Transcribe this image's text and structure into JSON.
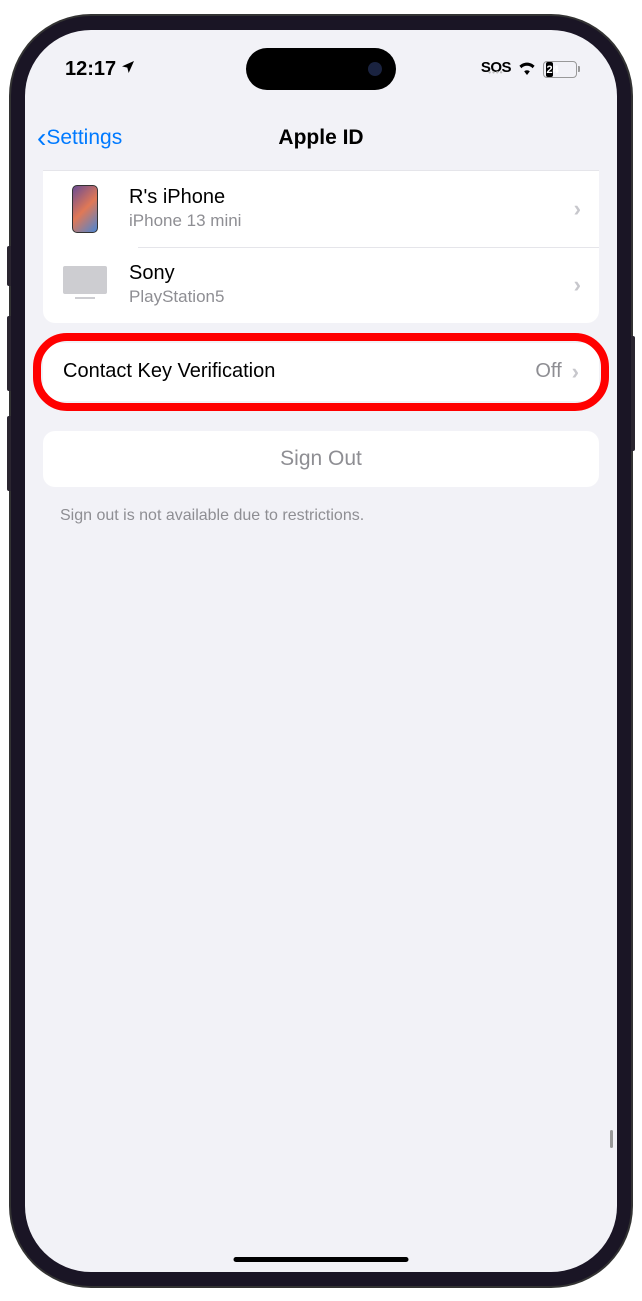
{
  "status": {
    "time": "12:17",
    "sos": "SOS",
    "battery_level": "24"
  },
  "nav": {
    "back_label": "Settings",
    "title": "Apple ID"
  },
  "devices": [
    {
      "name": "R's iPhone",
      "subtitle": "iPhone 13 mini"
    },
    {
      "name": "Sony",
      "subtitle": "PlayStation5"
    }
  ],
  "contact_key": {
    "label": "Contact Key Verification",
    "value": "Off"
  },
  "sign_out": {
    "label": "Sign Out",
    "footer": "Sign out is not available due to restrictions."
  }
}
